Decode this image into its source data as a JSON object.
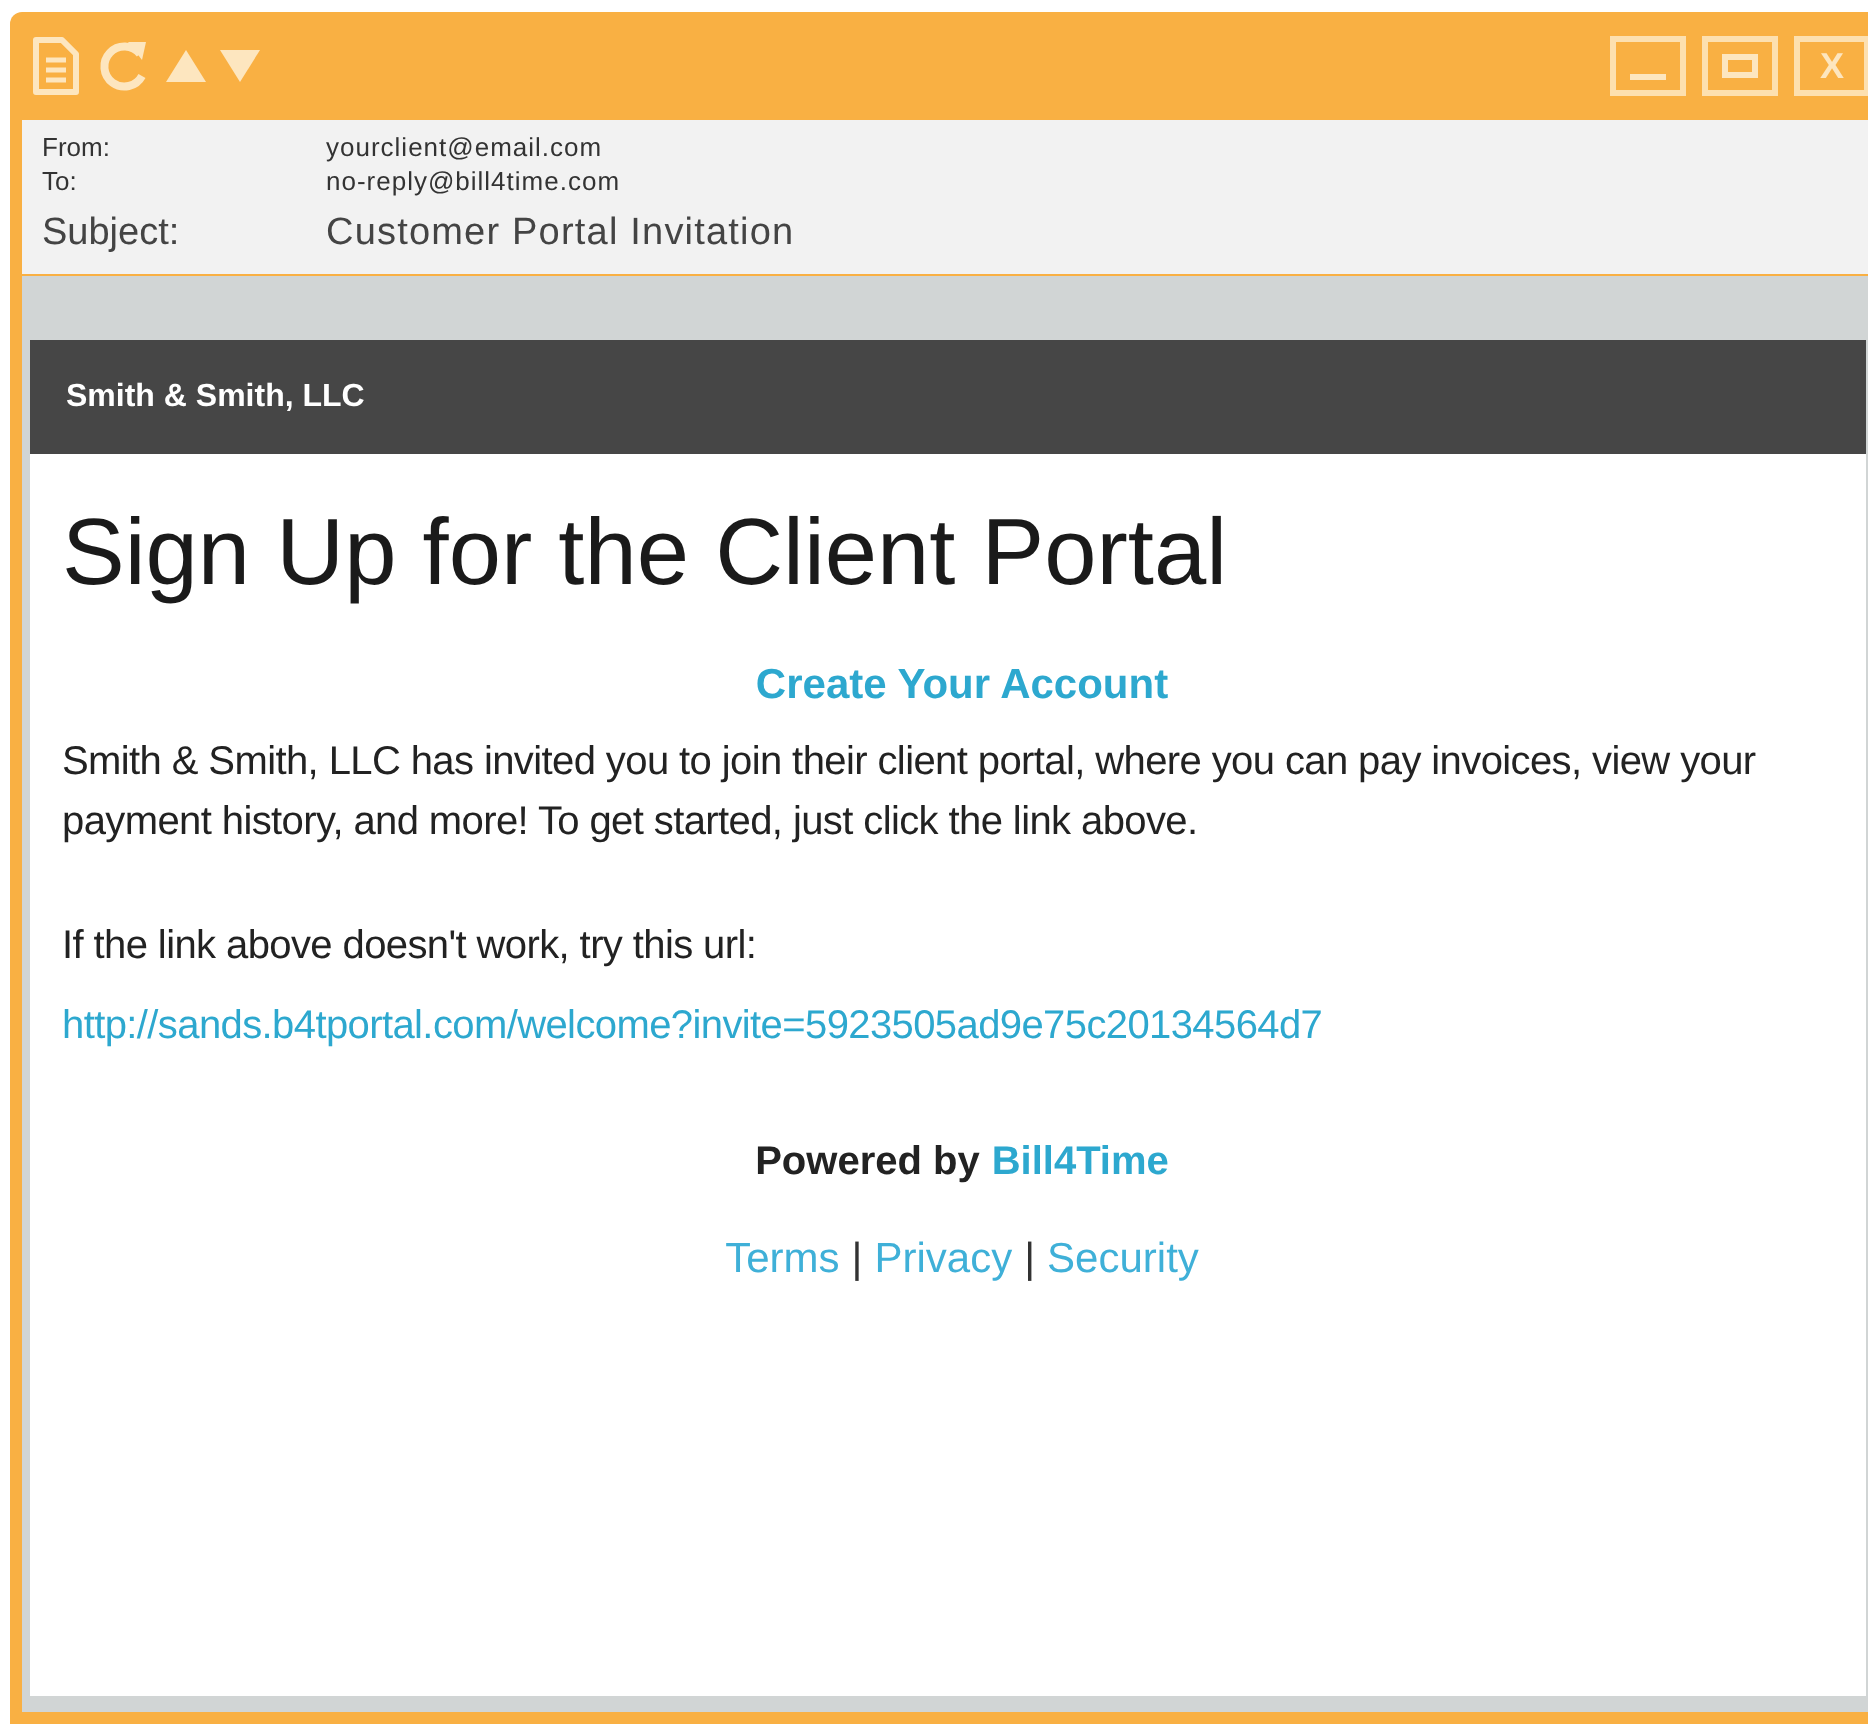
{
  "toolbar": {
    "buttons": [
      {
        "kind": "document"
      },
      {
        "kind": "refresh"
      },
      {
        "kind": "up"
      },
      {
        "kind": "down"
      }
    ]
  },
  "window_controls": [
    {
      "kind": "minimize"
    },
    {
      "kind": "maximize"
    },
    {
      "kind": "close",
      "label": "X"
    }
  ],
  "headers": {
    "from_label": "From:",
    "from": "yourclient@email.com",
    "to_label": "To:",
    "to": "no-reply@bill4time.com",
    "subject_label": "Subject:",
    "subject": "Customer Portal Invitation"
  },
  "email": {
    "brand": "Smith & Smith, LLC",
    "heading": "Sign Up for the Client Portal",
    "cta": "Create Your Account",
    "paragraph": "Smith & Smith, LLC has invited you to join their client portal, where you can pay invoices, view your payment history, and more! To get started, just click the link above.",
    "fallback": "If the link above doesn't work, try this url:",
    "url": "http://sands.b4tportal.com/welcome?invite=5923505ad9e75c20134564d7",
    "powered_by": "Powered by",
    "powered_link": "Bill4Time",
    "footer": [
      {
        "kind": "link",
        "text": "Terms"
      },
      {
        "kind": "separator",
        "text": "|"
      },
      {
        "kind": "link",
        "text": "Privacy"
      },
      {
        "kind": "separator",
        "text": "|"
      },
      {
        "kind": "link",
        "text": "Security"
      }
    ]
  }
}
